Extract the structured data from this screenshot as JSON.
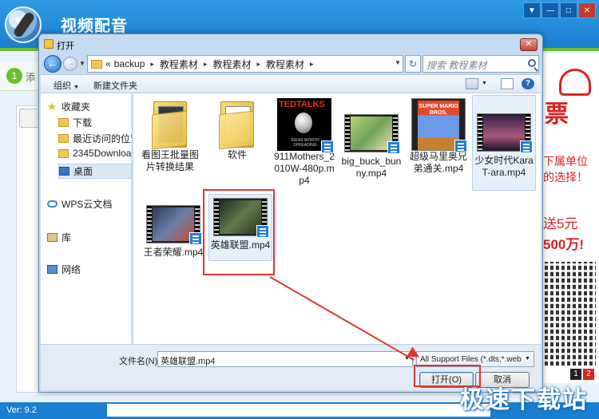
{
  "app": {
    "title": "视频配音",
    "step_num": "1",
    "step_text": "添",
    "version": "Ver: 9.2",
    "window_controls": [
      "▼",
      "—",
      "□",
      "✕"
    ]
  },
  "ad": {
    "piao": "票",
    "line1": "下属单位",
    "line2": "的选择！",
    "line3": "送5元",
    "line4": "500万!",
    "pages": [
      "1",
      "2"
    ]
  },
  "watermark": "极速下载站",
  "dialog": {
    "title": "打开",
    "close": "✕",
    "nav": {
      "back": "←",
      "forward": "→",
      "path_prefix": "«",
      "path": [
        "backup",
        "教程素材",
        "教程素材",
        "教程素材"
      ],
      "refresh": "↻",
      "search_placeholder": "搜索 教程素材"
    },
    "toolbar": {
      "organize": "组织",
      "new_folder": "新建文件夹",
      "help": "?"
    },
    "sidebar": [
      {
        "label": "收藏夹",
        "icon": "star-icon"
      },
      {
        "label": "下载",
        "icon": "folder-icon"
      },
      {
        "label": "最近访问的位置",
        "icon": "recent-icon"
      },
      {
        "label": "2345Downloads",
        "icon": "folder-icon"
      },
      {
        "label": "桌面",
        "icon": "desktop-icon"
      },
      {
        "label": "WPS云文档",
        "icon": "cloud-icon"
      },
      {
        "label": "库",
        "icon": "library-icon"
      },
      {
        "label": "网络",
        "icon": "network-icon"
      }
    ],
    "files": [
      {
        "label": "看图王批量图片转换结果",
        "type": "folder"
      },
      {
        "label": "软件",
        "type": "folder"
      },
      {
        "label": "911Mothers_2010W-480p.mp4",
        "type": "video"
      },
      {
        "label": "big_buck_bunny.mp4",
        "type": "video"
      },
      {
        "label": "超级马里奥兄弟通关.mp4",
        "type": "video"
      },
      {
        "label": "少女时代KaraT-ara.mp4",
        "type": "video"
      },
      {
        "label": "王者荣耀.mp4",
        "type": "video"
      },
      {
        "label": "英雄联盟.mp4",
        "type": "video"
      }
    ],
    "ted": {
      "logo": "TEDTALKS",
      "caption": "IDEAS WORTH SPREADING"
    },
    "mario_text": "SUPER MARIO BROS.",
    "filename_label": "文件名(N):",
    "filename_value": "英雄联盟.mp4",
    "filter_value": "All Support Files (*.dts;*.web",
    "open_button": "打开(O)",
    "cancel_button": "取消"
  }
}
